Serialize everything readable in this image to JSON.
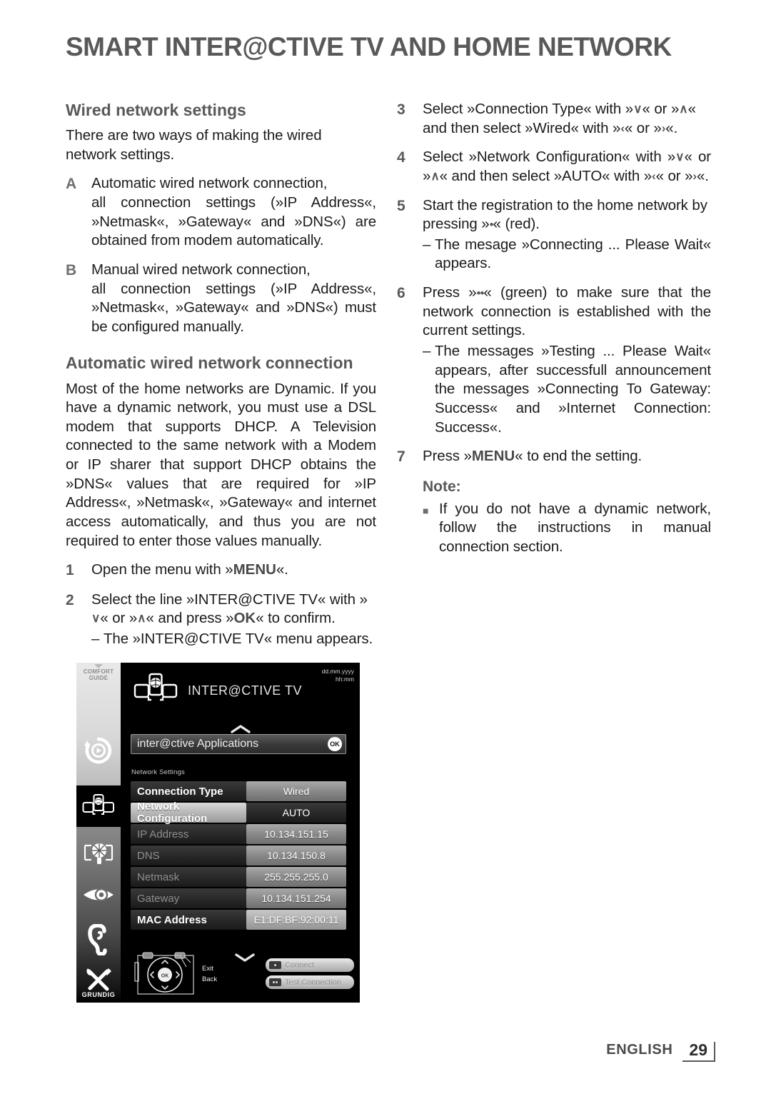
{
  "header": {
    "chapter_title": "SMART INTER@CTIVE TV AND HOME NETWORK"
  },
  "left_column": {
    "section1_title": "Wired network settings",
    "intro": "There are two ways of making the wired network settings.",
    "option_a_marker": "A",
    "option_a_line1": "Automatic wired network connection,",
    "option_a_line2": "all connection settings (»IP Address«, »Netmask«, »Gateway« and »DNS«) are obtained from modem automatically.",
    "option_b_marker": "B",
    "option_b_line1": "Manual wired network connection,",
    "option_b_line2": "all connection settings (»IP Address«, »Netmask«, »Gateway« and »DNS«) must be configured manually.",
    "section2_title": "Automatic wired network connection",
    "para2": "Most of the home networks are Dynamic. If you have a dynamic network, you must use a DSL modem that supports DHCP. A Television connected to the same network with a Modem or IP sharer that support DHCP obtains the »DNS« values that are required for »IP Address«, »Netmask«, »Gateway« and internet access automatically, and thus you are not required to enter those values manually.",
    "step1_num": "1",
    "step1_pre": "Open the menu with »",
    "step1_key": "MENU",
    "step1_post": "«.",
    "step2_num": "2",
    "step2_a": "Select the line »INTER@CTIVE TV« with »",
    "step2_arrow_down": "∨",
    "step2_b": "« or »",
    "step2_arrow_up": "∧",
    "step2_c": "« and press »",
    "step2_key_ok": "OK",
    "step2_d": "« to confirm.",
    "step2_dash": "–",
    "step2_sub": "The »INTER@CTIVE TV« menu appears."
  },
  "right_column": {
    "step3_num": "3",
    "step3_a": "Select »Connection Type« with »",
    "step3_arrow_down": "∨",
    "step3_b": "« or »",
    "step3_arrow_up": "∧",
    "step3_c": "« and then select »Wired« with »",
    "step3_arrow_left": "‹",
    "step3_d": "« or »",
    "step3_arrow_right": "›",
    "step3_e": "«.",
    "step4_num": "4",
    "step4_a": "Select »Network Configuration« with »",
    "step4_arrow_down": "∨",
    "step4_b": "« or »",
    "step4_arrow_up": "∧",
    "step4_c": "« and then select »AUTO« with »",
    "step4_arrow_left": "‹",
    "step4_d": "« or »",
    "step4_arrow_right": "›",
    "step4_e": "«.",
    "step5_num": "5",
    "step5_a": "Start the registration to the home network by pressing »",
    "step5_key": "•",
    "step5_b": "« (red).",
    "step5_dash": "–",
    "step5_sub": "The mesage »Connecting ... Please Wait« appears.",
    "step6_num": "6",
    "step6_a": "Press »",
    "step6_key": "••",
    "step6_b": "« (green) to make sure that the network connection is established with the current settings.",
    "step6_dash": "–",
    "step6_sub": "The messages »Testing ... Please Wait« appears, after successfull announcement the messages »Connecting To Gateway: Success« and »Internet Connection: Success«.",
    "step7_num": "7",
    "step7_pre": "Press »",
    "step7_key": "MENU",
    "step7_post": "« to end the setting.",
    "note_title": "Note:",
    "note_bullet": "■",
    "note_text": "If you do not have a dynamic network, follow the instructions in manual connection section."
  },
  "tv_screenshot": {
    "rail": {
      "comfort_line1": "COMFORT",
      "comfort_line2": "GUIDE",
      "brand": "GRUNDIG",
      "icons": [
        "timeshift-icon",
        "interactive-tv-icon",
        "network-settings-icon",
        "eye-icon",
        "ear-icon",
        "tools-icon"
      ]
    },
    "date_text": "dd.mm.yyyy",
    "time_text": "hh:mm",
    "menu_title": "INTER@CTIVE TV",
    "applications_row": {
      "label": "inter@ctive Applications",
      "badge": "OK"
    },
    "section_label": "Network Settings",
    "settings": [
      {
        "name": "Connection Type",
        "value": "Wired",
        "name_style": "dark",
        "value_style": "light"
      },
      {
        "name": "Network Configuration",
        "value": "AUTO",
        "name_style": "highlight",
        "value_style": "dark"
      },
      {
        "name": "IP Address",
        "value": "10.134.151.15",
        "name_style": "dim",
        "value_style": "light"
      },
      {
        "name": "DNS",
        "value": "10.134.150.8",
        "name_style": "dim",
        "value_style": "light"
      },
      {
        "name": "Netmask",
        "value": "255.255.255.0",
        "name_style": "dim",
        "value_style": "light"
      },
      {
        "name": "Gateway",
        "value": "10.134.151.254",
        "name_style": "dim",
        "value_style": "light"
      },
      {
        "name": "MAC Address",
        "value": "E1:DF:BF:92:00:11",
        "name_style": "dark",
        "value_style": "mac"
      }
    ],
    "remote": {
      "ok_label": "OK",
      "exit_label": "Exit",
      "back_label": "Back"
    },
    "buttons": [
      {
        "label": "Connect",
        "dots": 1
      },
      {
        "label": "Test Connection",
        "dots": 2
      }
    ]
  },
  "footer": {
    "language": "ENGLISH",
    "page_number": "29"
  }
}
